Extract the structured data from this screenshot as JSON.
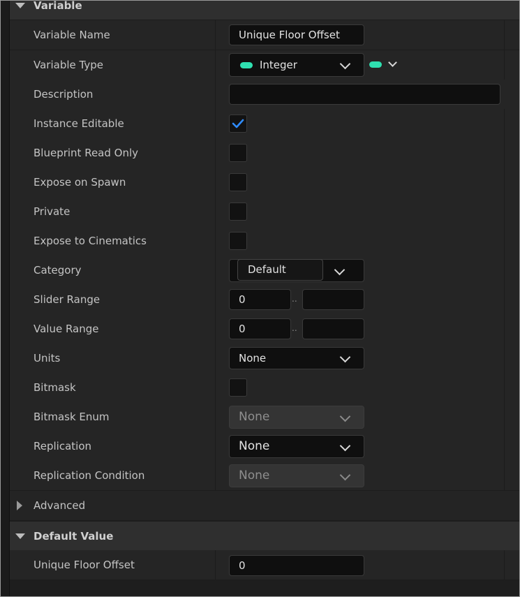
{
  "sections": {
    "variable": "Variable",
    "advanced": "Advanced",
    "default_value": "Default Value"
  },
  "rows": {
    "variable_name": {
      "label": "Variable Name",
      "value": "Unique Floor Offset"
    },
    "variable_type": {
      "label": "Variable Type",
      "value": "Integer"
    },
    "description": {
      "label": "Description",
      "value": ""
    },
    "instance_editable": {
      "label": "Instance Editable",
      "checked": true
    },
    "blueprint_read_only": {
      "label": "Blueprint Read Only",
      "checked": false
    },
    "expose_on_spawn": {
      "label": "Expose on Spawn",
      "checked": false
    },
    "private": {
      "label": "Private",
      "checked": false
    },
    "expose_to_cinematics": {
      "label": "Expose to Cinematics",
      "checked": false
    },
    "category": {
      "label": "Category",
      "value": "Default"
    },
    "slider_range": {
      "label": "Slider Range",
      "min": "0",
      "separator": "..",
      "max": ""
    },
    "value_range": {
      "label": "Value Range",
      "min": "0",
      "separator": "..",
      "max": ""
    },
    "units": {
      "label": "Units",
      "value": "None"
    },
    "bitmask": {
      "label": "Bitmask",
      "checked": false
    },
    "bitmask_enum": {
      "label": "Bitmask Enum",
      "value": "None"
    },
    "replication": {
      "label": "Replication",
      "value": "None"
    },
    "replication_condition": {
      "label": "Replication Condition",
      "value": "None"
    },
    "default_unique_floor_offset": {
      "label": "Unique Floor Offset",
      "value": "0"
    }
  },
  "colors": {
    "integer_pin": "#2fe0b0",
    "checkmark": "#2f8cff"
  },
  "icons": [
    "collapse-arrow-icon",
    "expand-arrow-icon",
    "chevron-down-icon",
    "checkmark-icon",
    "integer-type-icon"
  ]
}
